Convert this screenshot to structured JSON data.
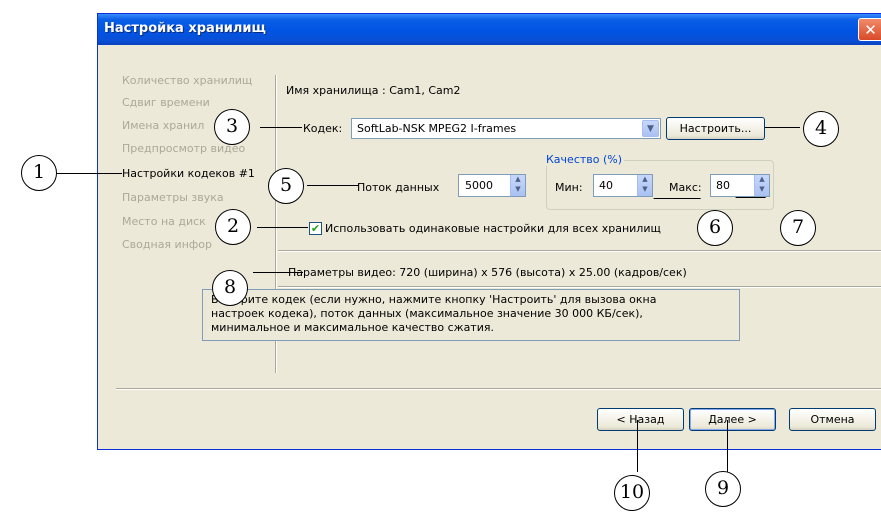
{
  "window": {
    "title": "Настройка хранилищ",
    "close_symbol": "✕"
  },
  "sidebar": {
    "items": [
      {
        "label": "Количество хранилищ",
        "active": false
      },
      {
        "label": "Сдвиг времени",
        "active": false
      },
      {
        "label": "Имена хранил",
        "active": false
      },
      {
        "label": "Предпросмотр видео",
        "active": false
      },
      {
        "label": "Настройки кодеков #1",
        "active": true
      },
      {
        "label": "Параметры звука",
        "active": false
      },
      {
        "label": "Место на диск",
        "active": false
      },
      {
        "label": "Сводная инфор",
        "active": false
      }
    ]
  },
  "main": {
    "storage_name": "Имя хранилища : Cam1, Cam2",
    "codec_label": "Кодек:",
    "codec_value": "SoftLab-NSK MPEG2 I-frames",
    "configure_button": "Настроить...",
    "bitrate_label": "Поток данных",
    "bitrate_value": "5000",
    "quality_group_title": "Качество (%)",
    "min_label": "Мин:",
    "min_value": "40",
    "max_label": "Макс:",
    "max_value": "80",
    "same_settings_label": "Использовать одинаковые настройки для всех хранилищ",
    "same_settings_checked": true,
    "video_params": "Параметры видео: 720 (ширина) x 576 (высота) x 25.00 (кадров/сек)",
    "hint_line1": "Выберите кодек (если нужно, нажмите кнопку 'Настроить' для вызова окна",
    "hint_line2": "настроек кодека), поток данных (максимальное значение 30 000 КБ/сек),",
    "hint_line3": "минимальное и максимальное качество сжатия."
  },
  "footer": {
    "back_button": "< Назад",
    "next_button": "Далее >",
    "cancel_button": "Отмена"
  },
  "callouts": [
    "1",
    "2",
    "3",
    "4",
    "5",
    "6",
    "7",
    "8",
    "9",
    "10"
  ],
  "icons": {
    "dropdown": "▼",
    "spin_up": "▲",
    "spin_down": "▼",
    "check": "✔"
  },
  "colors": {
    "title_bar": "#0054e3",
    "dialog_bg": "#ece9d8",
    "group_title": "#0046d5",
    "inactive_text": "#aca899"
  }
}
